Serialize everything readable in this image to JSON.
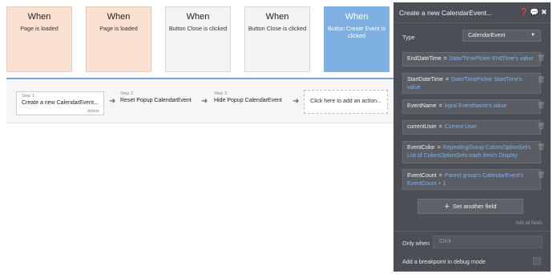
{
  "events": [
    {
      "title": "When",
      "desc": "Page is loaded"
    },
    {
      "title": "When",
      "desc": "Page is loaded"
    },
    {
      "title": "When",
      "desc": "Button Close is clicked"
    },
    {
      "title": "When",
      "desc": "Button Close is clicked"
    },
    {
      "title": "When",
      "desc": "Button Create Event is clicked"
    }
  ],
  "steps": [
    {
      "num": "Step 1",
      "title": "Create a new CalendarEvent...",
      "delete": "delete"
    },
    {
      "num": "Step 2",
      "title": "Reset Popup CalendarEvent"
    },
    {
      "num": "Step 3",
      "title": "Hide Popup CalendarEvent"
    }
  ],
  "add_action": "Click here to add an action...",
  "panel": {
    "title": "Create a new CalendarEvent...",
    "type_label": "Type",
    "type_value": "CalendarEvent",
    "fields": [
      {
        "key": "EndDateTime",
        "value": "Date/TimePicker EndTime's value"
      },
      {
        "key": "StartDateTime",
        "value": "Date/TimePicker StartTime's value"
      },
      {
        "key": "EventName",
        "value": "Input EventName's value"
      },
      {
        "key": "currentUser",
        "value": "Current User"
      },
      {
        "key": "EventColor",
        "value": "RepeatingGroup ColorsOptionSet's List of ColorsOptionSets:each item's Display"
      },
      {
        "key": "EventCount",
        "value": "Parent group's CalendarEvent's EventCount + 1"
      }
    ],
    "set_another": "Set another field",
    "add_all": "Add all fields",
    "only_when_label": "Only when",
    "only_when_placeholder": "Click",
    "breakpoint_label": "Add a breakpoint in debug mode"
  },
  "colors": {
    "peach": "#fbe1d2",
    "grey": "#f3f4f4",
    "blue": "#7eb0e2",
    "panel": "#4b4f55",
    "link": "#7fb2ef"
  }
}
